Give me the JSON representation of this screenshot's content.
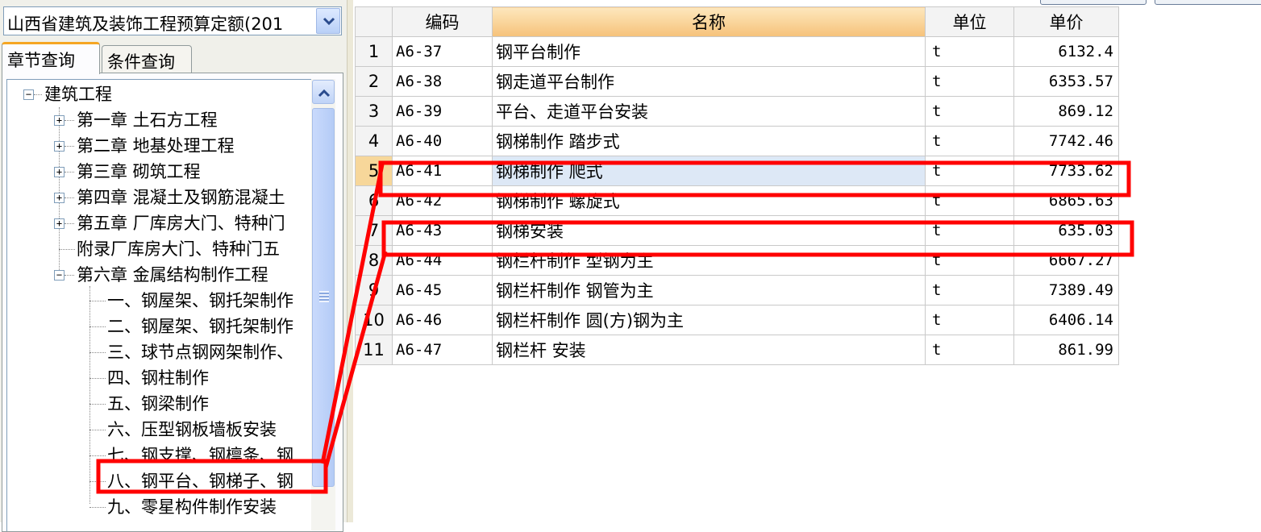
{
  "quota_selector": {
    "value": "山西省建筑及装饰工程预算定额(201"
  },
  "tabs": [
    {
      "label": "章节查询",
      "active": true
    },
    {
      "label": "条件查询",
      "active": false
    }
  ],
  "tree": {
    "root": "建筑工程",
    "chapters": [
      "第一章 土石方工程",
      "第二章 地基处理工程",
      "第三章 砌筑工程",
      "第四章 混凝土及钢筋混凝土",
      "第五章 厂库房大门、特种门",
      "附录厂库房大门、特种门五",
      "第六章 金属结构制作工程"
    ],
    "sections": [
      "一、钢屋架、钢托架制作",
      "二、钢屋架、钢托架制作",
      "三、球节点钢网架制作、",
      "四、钢柱制作",
      "五、钢梁制作",
      "六、压型钢板墙板安装",
      "七、钢支撑、钢檩条、钢",
      "八、钢平台、钢梯子、钢",
      "九、零星构件制作安装"
    ]
  },
  "grid": {
    "headers": [
      "编码",
      "名称",
      "单位",
      "单价"
    ],
    "rows": [
      {
        "no": "1",
        "code": "A6-37",
        "name": "钢平台制作",
        "unit": "t",
        "price": "6132.4"
      },
      {
        "no": "2",
        "code": "A6-38",
        "name": "钢走道平台制作",
        "unit": "t",
        "price": "6353.57"
      },
      {
        "no": "3",
        "code": "A6-39",
        "name": "平台、走道平台安装",
        "unit": "t",
        "price": "869.12"
      },
      {
        "no": "4",
        "code": "A6-40",
        "name": "钢梯制作 踏步式",
        "unit": "t",
        "price": "7742.46"
      },
      {
        "no": "5",
        "code": "A6-41",
        "name": "钢梯制作 爬式",
        "unit": "t",
        "price": "7733.62"
      },
      {
        "no": "6",
        "code": "A6-42",
        "name": "钢梯制作 螺旋式",
        "unit": "t",
        "price": "6865.63"
      },
      {
        "no": "7",
        "code": "A6-43",
        "name": "钢梯安装",
        "unit": "t",
        "price": "635.03"
      },
      {
        "no": "8",
        "code": "A6-44",
        "name": "钢栏杆制作 型钢为主",
        "unit": "t",
        "price": "6667.27"
      },
      {
        "no": "9",
        "code": "A6-45",
        "name": "钢栏杆制作 钢管为主",
        "unit": "t",
        "price": "7389.49"
      },
      {
        "no": "10",
        "code": "A6-46",
        "name": "钢栏杆制作 圆(方)钢为主",
        "unit": "t",
        "price": "6406.14"
      },
      {
        "no": "11",
        "code": "A6-47",
        "name": "钢栏杆 安装",
        "unit": "t",
        "price": "861.99"
      }
    ]
  },
  "colors": {
    "annotation": "#ff0000",
    "sorted_header": "#f6c27a",
    "selected_row": "#dde8f6"
  }
}
